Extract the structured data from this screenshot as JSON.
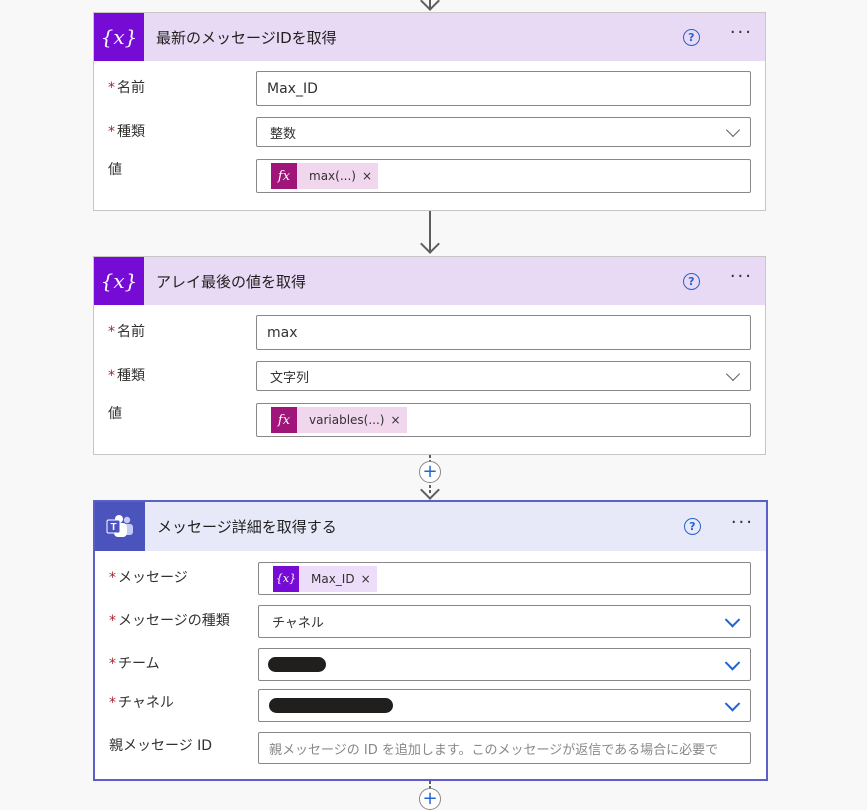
{
  "card1": {
    "title": "最新のメッセージIDを取得",
    "icon": "variable-icon",
    "name_label": "名前",
    "name_value": "Max_ID",
    "type_label": "種類",
    "type_value": "整数",
    "value_label": "値",
    "value_token": "max(...)"
  },
  "card2": {
    "title": "アレイ最後の値を取得",
    "icon": "variable-icon",
    "name_label": "名前",
    "name_value": "max",
    "type_label": "種類",
    "type_value": "文字列",
    "value_label": "値",
    "value_token": "variables(...)"
  },
  "card3": {
    "title": "メッセージ詳細を取得する",
    "icon": "teams-icon",
    "message_label": "メッセージ",
    "message_token": "Max_ID",
    "message_type_label": "メッセージの種類",
    "message_type_value": "チャネル",
    "team_label": "チーム",
    "channel_label": "チャネル",
    "parent_label": "親メッセージ ID",
    "parent_placeholder": "親メッセージの ID を追加します。このメッセージが返信である場合に必要で"
  },
  "common": {
    "required_mark": "*",
    "token_close": "×",
    "help_glyph": "?",
    "more_glyph": "···",
    "plus_glyph": "+",
    "fx_glyph": "fx",
    "var_glyph": "{x}"
  },
  "colors": {
    "variable_accent": "#770bd6",
    "teams_accent": "#4b53bc",
    "expression_token": "#a0157a",
    "link_blue": "#2264d1"
  }
}
